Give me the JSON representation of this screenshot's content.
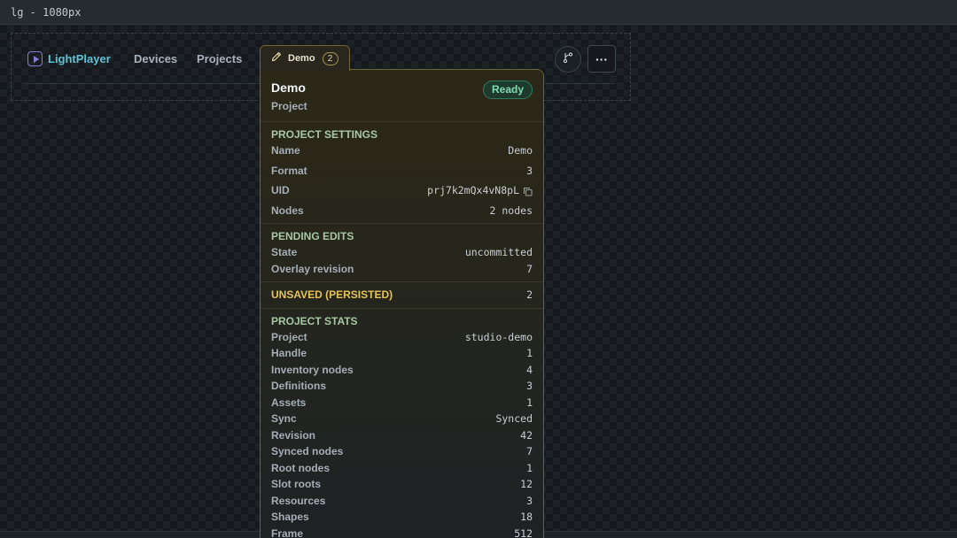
{
  "viewport_label": "lg - 1080px",
  "brand": {
    "name": "LightPlayer",
    "icon": "play-square-icon"
  },
  "nav": {
    "devices": "Devices",
    "projects": "Projects"
  },
  "tab": {
    "label": "Demo",
    "badge": "2",
    "icon": "pencil-icon"
  },
  "toolbar": {
    "branch_icon": "git-branch-icon",
    "more_label": "···"
  },
  "panel": {
    "title": "Demo",
    "subtitle": "Project",
    "status": "Ready",
    "project_settings": {
      "title": "PROJECT SETTINGS",
      "rows": [
        {
          "key": "Name",
          "value": "Demo"
        },
        {
          "key": "Format",
          "value": "3"
        },
        {
          "key": "UID",
          "value": "prj7k2mQx4vN8pL",
          "icon": "copy-icon"
        },
        {
          "key": "Nodes",
          "value": "2 nodes"
        }
      ]
    },
    "pending_edits": {
      "title": "PENDING EDITS",
      "rows": [
        {
          "key": "State",
          "value": "uncommitted"
        },
        {
          "key": "Overlay revision",
          "value": "7"
        }
      ]
    },
    "unsaved": {
      "key": "UNSAVED (PERSISTED)",
      "value": "2"
    },
    "project_stats": {
      "title": "PROJECT STATS",
      "rows": [
        {
          "key": "Project",
          "value": "studio-demo"
        },
        {
          "key": "Handle",
          "value": "1"
        },
        {
          "key": "Inventory nodes",
          "value": "4"
        },
        {
          "key": "Definitions",
          "value": "3"
        },
        {
          "key": "Assets",
          "value": "1"
        },
        {
          "key": "Sync",
          "value": "Synced"
        },
        {
          "key": "Revision",
          "value": "42"
        },
        {
          "key": "Synced nodes",
          "value": "7"
        },
        {
          "key": "Root nodes",
          "value": "1"
        },
        {
          "key": "Slot roots",
          "value": "12"
        },
        {
          "key": "Resources",
          "value": "3"
        },
        {
          "key": "Shapes",
          "value": "18"
        },
        {
          "key": "Frame",
          "value": "512"
        }
      ]
    }
  },
  "colors": {
    "accent_teal": "#5ec3d6",
    "ready_green": "#7fdcae",
    "warning_yellow": "#e6c25a",
    "section_green": "#a7c8a4"
  }
}
